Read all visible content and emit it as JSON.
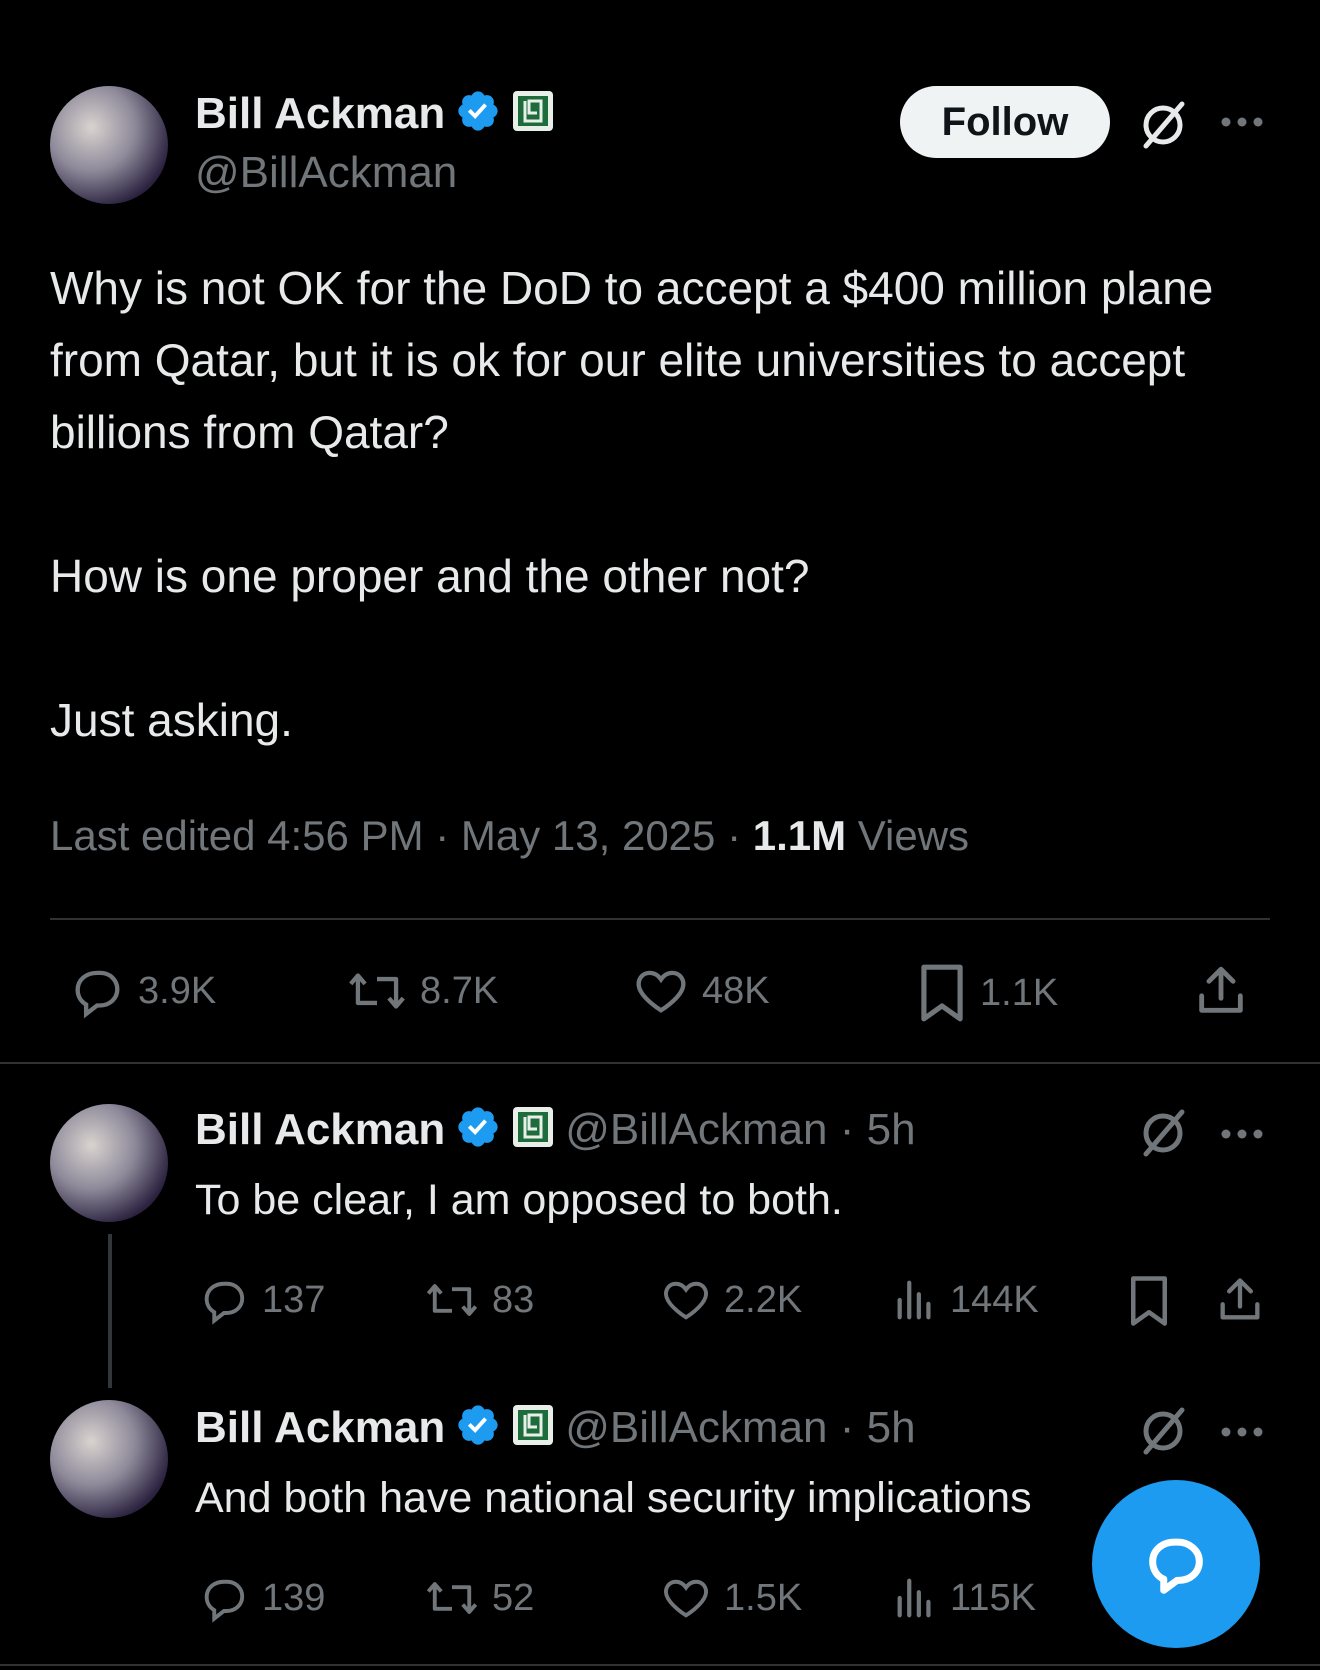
{
  "main_tweet": {
    "author_name": "Bill Ackman",
    "handle": "@BillAckman",
    "follow_label": "Follow",
    "paragraphs": [
      "Why is not OK for the DoD to accept a $400 million plane from Qatar, but it is ok for our elite universities to accept billions from Qatar?",
      "How is one proper and the other not?",
      "Just asking."
    ],
    "meta_prefix": "Last edited 4:56 PM · May 13, 2025 · ",
    "views_count": "1.1M",
    "views_label": " Views",
    "stats": {
      "replies": "3.9K",
      "reposts": "8.7K",
      "likes": "48K",
      "bookmarks": "1.1K"
    }
  },
  "replies": [
    {
      "author_name": "Bill Ackman",
      "handle_time": "@BillAckman · 5h",
      "text": "To be clear, I am opposed to both.",
      "stats": {
        "replies": "137",
        "reposts": "83",
        "likes": "2.2K",
        "views": "144K"
      }
    },
    {
      "author_name": "Bill Ackman",
      "handle_time": "@BillAckman · 5h",
      "text": "And both have national security implications",
      "stats": {
        "replies": "139",
        "reposts": "52",
        "likes": "1.5K",
        "views": "115K"
      }
    }
  ],
  "icons": {
    "verified": "verified-badge-icon",
    "affiliate": "affiliate-badge-icon",
    "grok": "grok-icon",
    "more": "more-icon",
    "reply": "reply-icon",
    "repost": "repost-icon",
    "like": "like-icon",
    "bookmark": "bookmark-icon",
    "views": "views-icon",
    "share": "share-icon",
    "compose": "compose-reply-icon"
  },
  "colors": {
    "background": "#000000",
    "accent": "#1d9bf0",
    "muted": "#71767b",
    "text": "#e7e9ea",
    "affiliate_green": "#1e6b3c"
  }
}
